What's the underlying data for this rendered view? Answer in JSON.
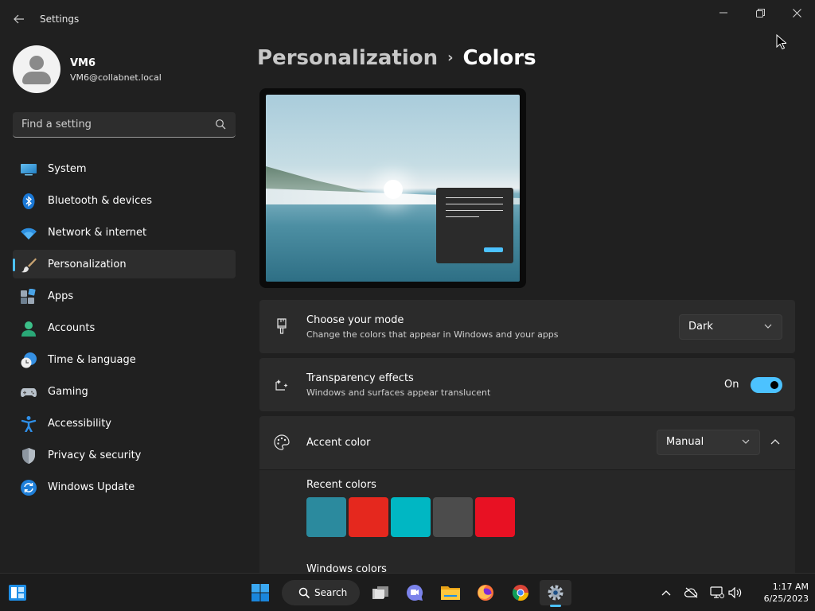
{
  "window": {
    "title": "Settings",
    "back_icon": "back-arrow-icon",
    "controls": [
      "minimize-icon",
      "restore-icon",
      "close-icon"
    ]
  },
  "profile": {
    "name": "VM6",
    "email": "VM6@collabnet.local"
  },
  "search": {
    "placeholder": "Find a setting"
  },
  "nav": {
    "items": [
      {
        "label": "System",
        "icon": "system-icon"
      },
      {
        "label": "Bluetooth & devices",
        "icon": "bluetooth-icon"
      },
      {
        "label": "Network & internet",
        "icon": "wifi-icon"
      },
      {
        "label": "Personalization",
        "icon": "brush-icon",
        "active": true
      },
      {
        "label": "Apps",
        "icon": "apps-icon"
      },
      {
        "label": "Accounts",
        "icon": "person-icon"
      },
      {
        "label": "Time & language",
        "icon": "clock-globe-icon"
      },
      {
        "label": "Gaming",
        "icon": "gamepad-icon"
      },
      {
        "label": "Accessibility",
        "icon": "accessibility-icon"
      },
      {
        "label": "Privacy & security",
        "icon": "shield-icon"
      },
      {
        "label": "Windows Update",
        "icon": "update-icon"
      }
    ]
  },
  "breadcrumb": {
    "parent": "Personalization",
    "separator": "›",
    "current": "Colors"
  },
  "mode_card": {
    "title": "Choose your mode",
    "description": "Change the colors that appear in Windows and your apps",
    "value": "Dark"
  },
  "transparency_card": {
    "title": "Transparency effects",
    "description": "Windows and surfaces appear translucent",
    "state_label": "On",
    "enabled": true
  },
  "accent_card": {
    "title": "Accent color",
    "value": "Manual",
    "recent_heading": "Recent colors",
    "recent_colors": [
      "#2b8a9e",
      "#e5281e",
      "#00b7c3",
      "#4c4c4c",
      "#e81123"
    ],
    "windows_heading": "Windows colors"
  },
  "taskbar": {
    "search_label": "Search",
    "apps": [
      "start-icon",
      "task-view-icon",
      "teams-chat-icon",
      "file-explorer-icon",
      "firefox-icon",
      "chrome-icon",
      "settings-icon"
    ],
    "tray": [
      "chevron-up-icon",
      "onedrive-offline-icon",
      "network-icon",
      "volume-icon"
    ],
    "time": "1:17 AM",
    "date": "6/25/2023"
  },
  "colors": {
    "accent": "#4cc2ff",
    "background": "#202020",
    "card": "#2b2b2b"
  }
}
